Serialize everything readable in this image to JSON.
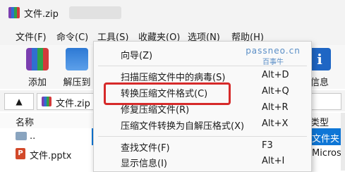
{
  "window": {
    "title": "文件.zip"
  },
  "menubar": {
    "items": [
      "文件(F)",
      "命令(C)",
      "工具(S)",
      "收藏夹(O)",
      "选项(N)",
      "帮助(H)"
    ]
  },
  "toolbar": {
    "add_label": "添加",
    "extract_label": "解压到",
    "info_label": "信息"
  },
  "addressbar": {
    "path": "文件.zip - ZI"
  },
  "file_list": {
    "columns": {
      "name": "名称",
      "type": "类型"
    },
    "rows": [
      {
        "name": "..",
        "type": "文件夹"
      },
      {
        "name": "文件.pptx",
        "type": "Microso"
      }
    ]
  },
  "dropdown": {
    "items": [
      {
        "label": "向导(Z)",
        "shortcut": ""
      },
      {
        "label": "扫描压缩文件中的病毒(S)",
        "shortcut": "Alt+D"
      },
      {
        "label": "转换压缩文件格式(C)",
        "shortcut": "Alt+Q"
      },
      {
        "label": "修复压缩文件(R)",
        "shortcut": "Alt+R"
      },
      {
        "label": "压缩文件转换为自解压格式(X)",
        "shortcut": "Alt+X"
      },
      {
        "label": "查找文件(F)",
        "shortcut": "F3"
      },
      {
        "label": "显示信息(I)",
        "shortcut": "Alt+I"
      }
    ]
  },
  "watermark": {
    "line1": "passneo.cn",
    "line2": "百事牛"
  },
  "colors": {
    "selection": "#0e76d6",
    "highlight_border": "#d62a2a"
  }
}
